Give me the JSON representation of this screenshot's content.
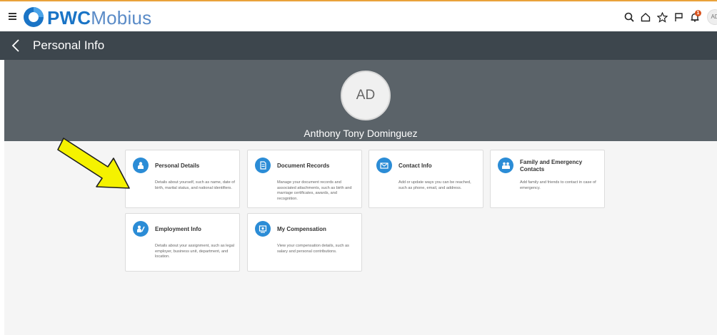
{
  "header": {
    "brand_bold": "PWC",
    "brand_light": "Mobius",
    "notification_count": "1",
    "user_initials": "AD"
  },
  "titlebar": {
    "title": "Personal Info"
  },
  "profile": {
    "initials": "AD",
    "name": "Anthony Tony Dominguez"
  },
  "cards": [
    {
      "title": "Personal Details",
      "description": "Details about yourself, such as name, date of birth, marital status, and national identifiers."
    },
    {
      "title": "Document Records",
      "description": "Manage your document records and associated attachments, such as birth and marriage certificates, awards, and recognition."
    },
    {
      "title": "Contact Info",
      "description": "Add or update ways you can be reached, such as phone, email, and address."
    },
    {
      "title": "Family and Emergency Contacts",
      "description": "Add family and friends to contact in case of emergency."
    },
    {
      "title": "Employment Info",
      "description": "Details about your assignment, such as legal employer, business unit, department, and location."
    },
    {
      "title": "My Compensation",
      "description": "View your compensation details, such as salary and personal contributions."
    }
  ],
  "colors": {
    "accent": "#2b8cd6",
    "titlebar": "#3d464d",
    "hero": "#5b6369",
    "annotation_arrow": "#f5f200"
  }
}
